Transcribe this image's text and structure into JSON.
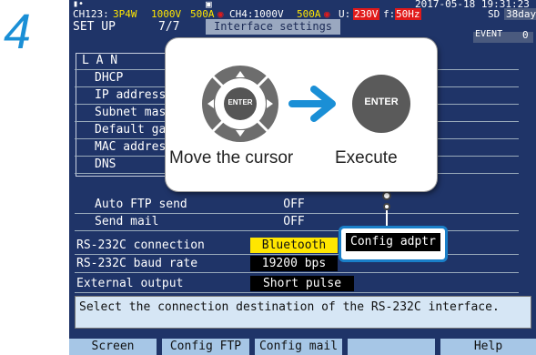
{
  "step_number": "4",
  "status": {
    "ch123": "CH123:",
    "wiring": "3P4W",
    "voltage_range": "1000V",
    "current_range": "500A",
    "ch4": "CH4:1000V",
    "ch4_current": "500A",
    "u_label": "U:",
    "u_value": "230V",
    "f_label": "f:",
    "f_value": "50Hz",
    "datetime": "2017-05-18 19:31:23",
    "sd_label": "SD",
    "sd_days": "38days"
  },
  "header": {
    "mode": "SET UP",
    "page": "7/7",
    "title": "Interface settings",
    "event_label": "EVENT",
    "event_count": "0"
  },
  "lan": {
    "title": "L A N",
    "items": [
      "DHCP",
      "IP address",
      "Subnet mask",
      "Default gateway",
      "MAC address",
      "DNS"
    ]
  },
  "settings": {
    "auto_ftp_label": "Auto FTP send",
    "auto_ftp_value": "OFF",
    "send_mail_label": "Send mail",
    "send_mail_value": "OFF",
    "rs232c_conn_label": "RS-232C connection",
    "rs232c_conn_value": "Bluetooth",
    "rs232c_baud_label": "RS-232C baud rate",
    "rs232c_baud_value": "19200 bps",
    "external_output_label": "External output",
    "external_output_value": "Short pulse"
  },
  "config_adapter_button": "Config adptr",
  "hint_text": "Select the connection destination of the RS-232C interface.",
  "fkeys": [
    "Screen",
    "Config FTP",
    "Config mail",
    "",
    "Help"
  ],
  "popup": {
    "enter_center": "ENTER",
    "enter_button": "ENTER",
    "caption_move": "Move the cursor",
    "caption_execute": "Execute"
  },
  "colors": {
    "screen_bg": "#1f3468",
    "highlight": "#ffe600",
    "accent_blue": "#1a8fd6",
    "alert_red": "#e11a1a"
  }
}
